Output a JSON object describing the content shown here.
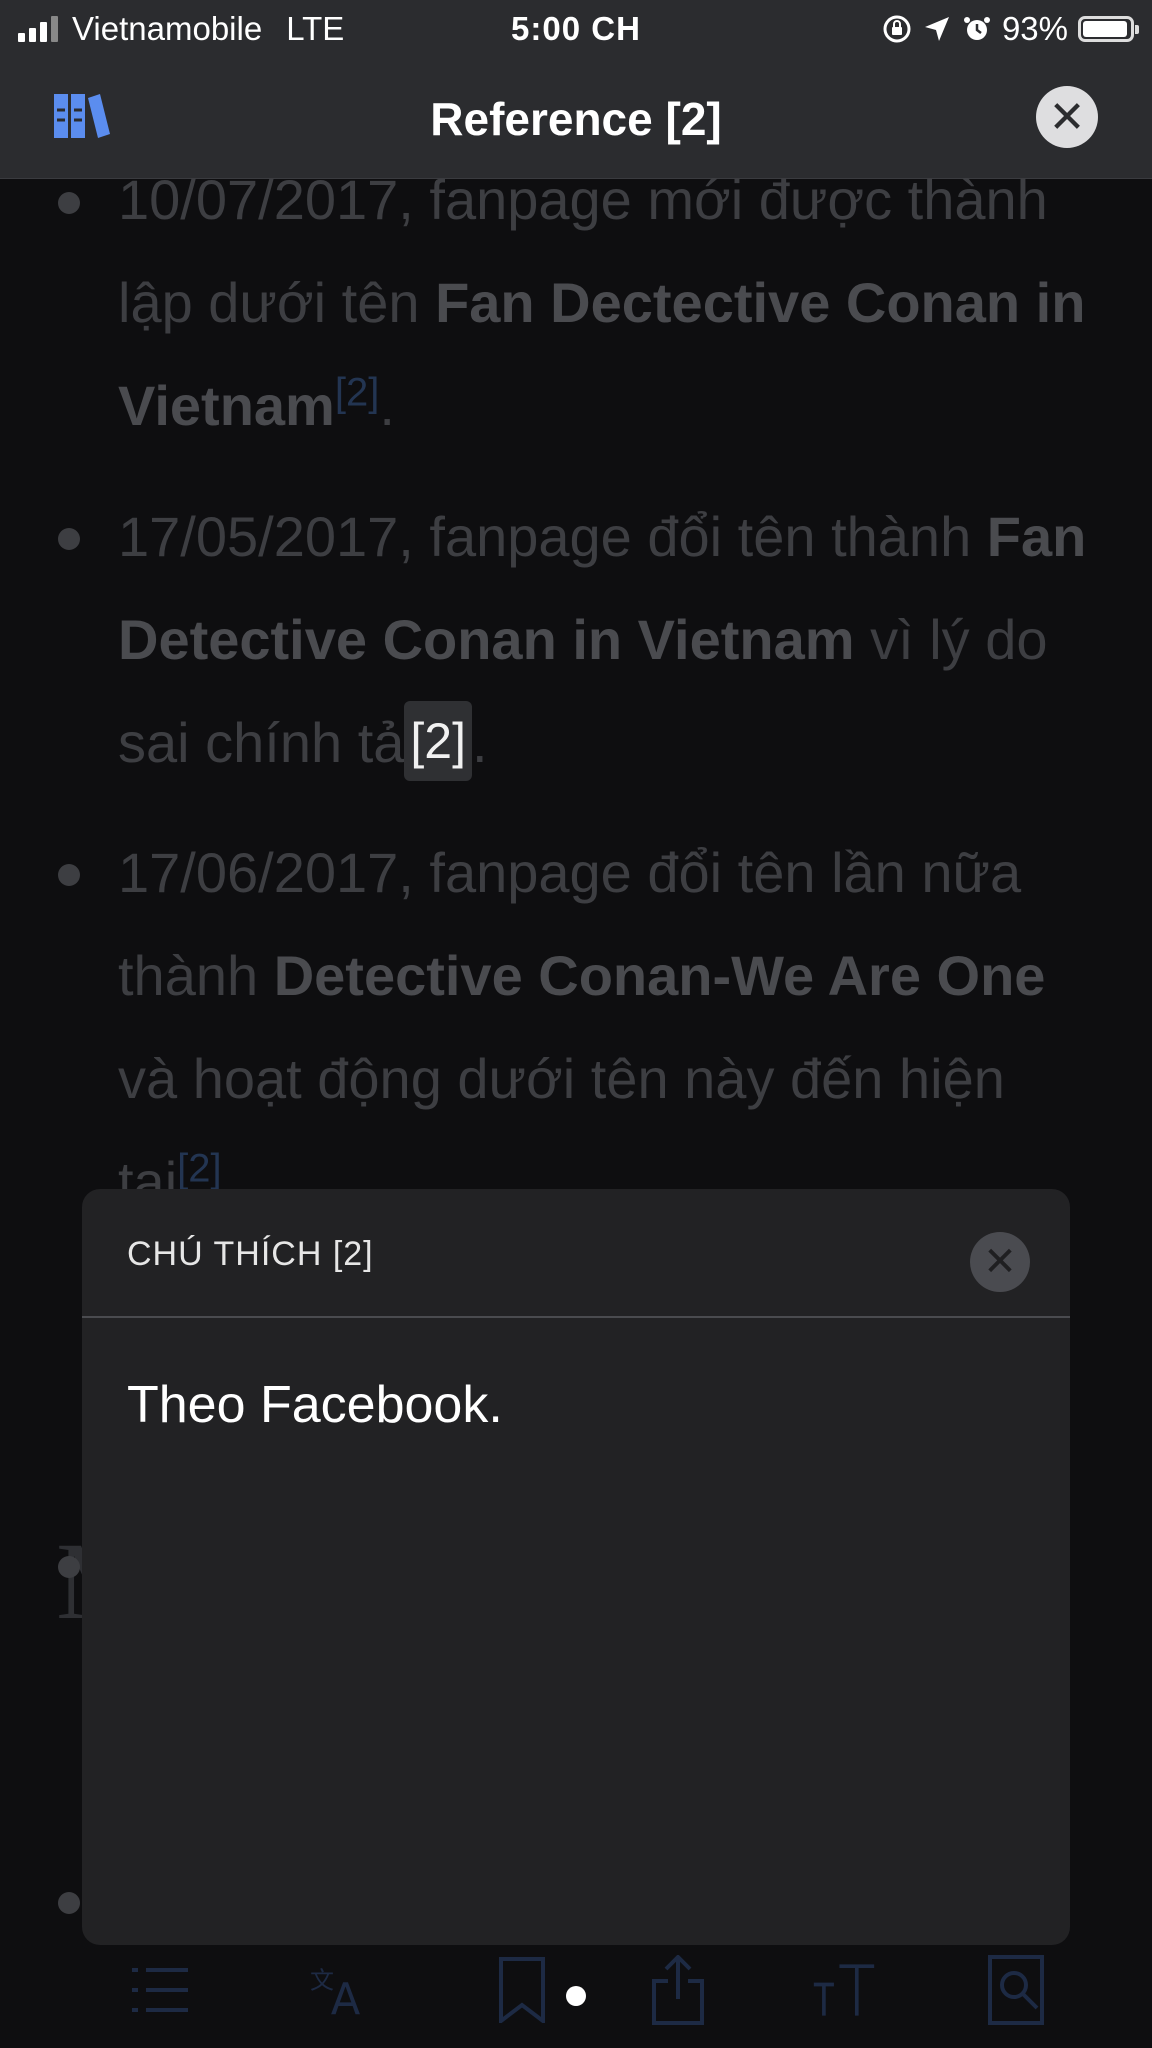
{
  "status_bar": {
    "carrier": "Vietnamobile",
    "network": "LTE",
    "time": "5:00 CH",
    "battery": "93%"
  },
  "nav": {
    "title": "Reference [2]",
    "left_icon": "library-icon",
    "close_icon": "close-icon"
  },
  "article": {
    "items": [
      {
        "date_text": "10/07/2017, fanpage mới được thành lập dưới tên ",
        "bold": "Fan Dectective Conan in Vietnam",
        "ref": "[2]",
        "tail": "."
      },
      {
        "date_text": "17/05/2017, fanpage đổi tên thành ",
        "bold": "Fan Detective Conan in Vietnam",
        "after_bold": " vì lý do sai chính tả",
        "ref": "[2]",
        "tail": "."
      },
      {
        "date_text": "17/06/2017, fanpage đổi tên lần nữa thành ",
        "bold": "Detective Conan-We Are One",
        "after_bold": " và hoạt động dưới tên này đến hiện tại",
        "ref": "[2]"
      }
    ],
    "heading_fragment": "M"
  },
  "modal": {
    "title": "CHÚ THÍCH [2]",
    "body": "Theo Facebook."
  },
  "toolbar": {
    "icons": [
      "contents-icon",
      "language-icon",
      "bookmark-icon",
      "share-icon",
      "text-size-icon",
      "find-icon"
    ]
  }
}
